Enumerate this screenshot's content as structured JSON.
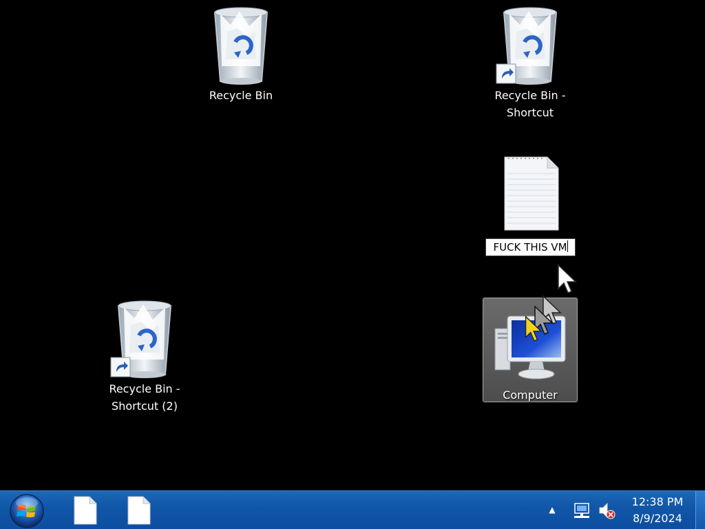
{
  "desktop": {
    "icons": [
      {
        "name": "recycle-bin",
        "label": "Recycle Bin",
        "icon": "recycle-bin-icon"
      },
      {
        "name": "recycle-bin-shortcut",
        "label": "Recycle Bin - Shortcut",
        "icon": "recycle-bin-icon",
        "shortcut": true
      },
      {
        "name": "text-file",
        "label": "FUCK THIS VM",
        "icon": "text-document-icon",
        "renaming": true
      },
      {
        "name": "recycle-bin-shortcut-2",
        "label": "Recycle Bin - Shortcut (2)",
        "icon": "recycle-bin-icon",
        "shortcut": true
      },
      {
        "name": "computer",
        "label": "Computer",
        "icon": "computer-icon",
        "selected": true
      }
    ]
  },
  "taskbar": {
    "start_icon": "windows-logo-icon",
    "pinned": [
      {
        "name": "taskbar-document-1",
        "icon": "blank-document-icon"
      },
      {
        "name": "taskbar-document-2",
        "icon": "blank-document-icon"
      }
    ],
    "tray": {
      "arrow_glyph": "▲",
      "network_icon": "network-icon",
      "volume_icon": "volume-muted-icon",
      "time": "12:38 PM",
      "date": "8/9/2024"
    }
  },
  "colors": {
    "taskbar": "#1157a8",
    "desktop": "#000000",
    "selection": "#5a5a5a"
  }
}
